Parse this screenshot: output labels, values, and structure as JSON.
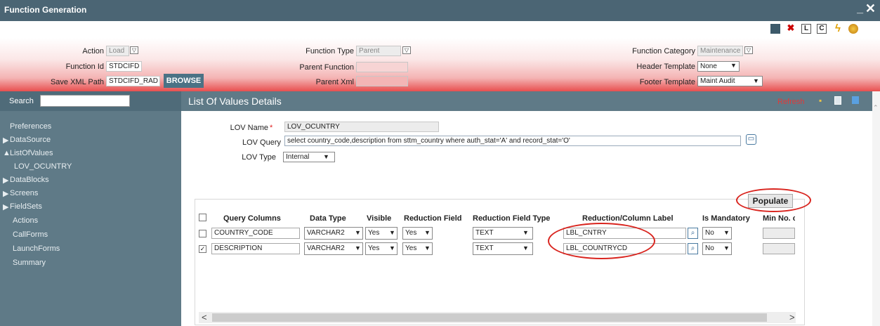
{
  "window": {
    "title": "Function Generation",
    "minimize": "_",
    "close": "✕"
  },
  "toolbar": {
    "icons": [
      "save-icon",
      "delete-icon",
      "l-icon",
      "c-icon",
      "lightning-icon",
      "globe-icon"
    ],
    "l_label": "L",
    "c_label": "C"
  },
  "header": {
    "action_label": "Action",
    "action_value": "Load",
    "function_id_label": "Function Id",
    "function_id_value": "STDCIFD",
    "save_xml_label": "Save XML Path",
    "save_xml_value": "STDCIFD_RAD",
    "browse_label": "BROWSE",
    "function_type_label": "Function Type",
    "function_type_value": "Parent",
    "parent_function_label": "Parent Function",
    "parent_function_value": "",
    "parent_xml_label": "Parent Xml",
    "parent_xml_value": "",
    "function_category_label": "Function Category",
    "function_category_value": "Maintenance",
    "header_template_label": "Header Template",
    "header_template_value": "None",
    "footer_template_label": "Footer Template",
    "footer_template_value": "Maint Audit"
  },
  "sidebar": {
    "search_label": "Search",
    "search_value": "",
    "items": [
      "Preferences",
      "DataSource",
      "ListOfValues",
      "LOV_OCUNTRY",
      "DataBlocks",
      "Screens",
      "FieldSets",
      "Actions",
      "CallForms",
      "LaunchForms",
      "Summary"
    ]
  },
  "content": {
    "title": "List Of Values Details",
    "refresh": "Refresh",
    "lov_name_label": "LOV Name",
    "required_mark": "*",
    "lov_name_value": "LOV_OCUNTRY",
    "lov_query_label": "LOV Query",
    "lov_query_value": "select country_code,description from sttm_country where auth_stat='A' and record_stat='O'",
    "lov_type_label": "LOV Type",
    "lov_type_value": "Internal",
    "populate_label": "Populate"
  },
  "table": {
    "headers": [
      "Query Columns",
      "Data Type",
      "Visible",
      "Reduction Field",
      "Reduction Field Type",
      "Reduction/Column Label",
      "Is Mandatory",
      "Min No. c"
    ],
    "rows": [
      {
        "checked": false,
        "query_column": "COUNTRY_CODE",
        "data_type": "VARCHAR2",
        "visible": "Yes",
        "reduction_field": "Yes",
        "reduction_field_type": "TEXT",
        "label": "LBL_CNTRY",
        "mandatory": "No"
      },
      {
        "checked": true,
        "query_column": "DESCRIPTION",
        "data_type": "VARCHAR2",
        "visible": "Yes",
        "reduction_field": "Yes",
        "reduction_field_type": "TEXT",
        "label": "LBL_COUNTRYCD",
        "mandatory": "No"
      }
    ],
    "check_mark": "✓",
    "scroll_left": "<",
    "scroll_right": ">"
  },
  "colors": {
    "titlebar": "#4b6574",
    "sidebar": "#5f7a87",
    "accent_red": "#e84f4f",
    "highlight_oval": "#d9251f"
  }
}
